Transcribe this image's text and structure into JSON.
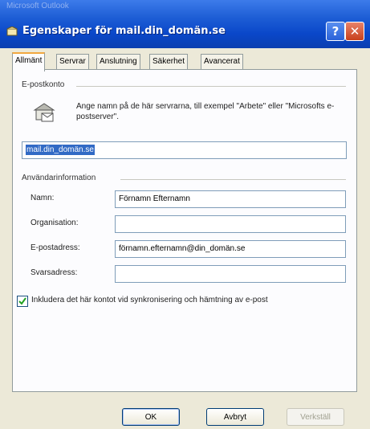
{
  "window": {
    "ghost_text": "Microsoft Outlook",
    "title": "Egenskaper för mail.din_domän.se",
    "help_glyph": "?",
    "close_glyph": "✕"
  },
  "tabs": [
    {
      "label": "Allmänt",
      "active": true
    },
    {
      "label": "Servrar",
      "active": false
    },
    {
      "label": "Anslutning",
      "active": false
    },
    {
      "label": "Säkerhet",
      "active": false
    },
    {
      "label": "Avancerat",
      "active": false
    }
  ],
  "account": {
    "section_label": "E-postkonto",
    "description": "Ange namn på de här servrarna, till exempel \"Arbete\" eller \"Microsofts e-postserver\".",
    "account_name_value": "mail.din_domän.se"
  },
  "user_info": {
    "section_label": "Användarinformation",
    "name_label": "Namn:",
    "name_value": "Förnamn Efternamn",
    "org_label": "Organisation:",
    "org_value": "",
    "email_label": "E-postadress:",
    "email_value": "förnamn.efternamn@din_domän.se",
    "reply_label": "Svarsadress:",
    "reply_value": ""
  },
  "include_checkbox": {
    "label": "Inkludera det här kontot vid synkronisering och hämtning av e-post",
    "checked": true
  },
  "buttons": {
    "ok": "OK",
    "cancel": "Avbryt",
    "apply": "Verkställ"
  }
}
